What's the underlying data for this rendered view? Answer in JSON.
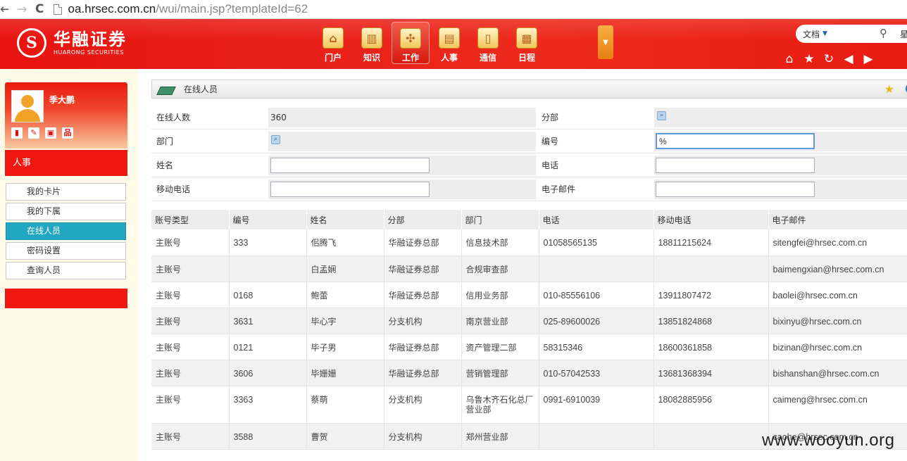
{
  "browser": {
    "url_host": "oa.hrsec.com.cn",
    "url_path": "/wui/main.jsp?templateId=62"
  },
  "header": {
    "logo_cn": "华融证券",
    "logo_en": "HUARONG SECURITIES",
    "modules": [
      {
        "label": "门户",
        "icon": "home-icon",
        "glyph": "⌂"
      },
      {
        "label": "知识",
        "icon": "book-icon",
        "glyph": "▥"
      },
      {
        "label": "工作",
        "icon": "workflow-icon",
        "glyph": "✣"
      },
      {
        "label": "人事",
        "icon": "document-icon",
        "glyph": "▤"
      },
      {
        "label": "通信",
        "icon": "phone-icon",
        "glyph": "▯"
      },
      {
        "label": "日程",
        "icon": "calendar-icon",
        "glyph": "▦"
      }
    ],
    "search_type": "文档",
    "search_extra": "星"
  },
  "sidebar": {
    "user_name": "季大鹏",
    "section_title": "人事",
    "menu": [
      {
        "label": "我的卡片",
        "active": false
      },
      {
        "label": "我的下属",
        "active": false
      },
      {
        "label": "在线人员",
        "active": true
      },
      {
        "label": "密码设置",
        "active": false
      },
      {
        "label": "查询人员",
        "active": false
      }
    ]
  },
  "panel": {
    "title": "在线人员"
  },
  "form": {
    "online_count_label": "在线人数",
    "online_count_value": "360",
    "branch_label": "分部",
    "dept_label": "部门",
    "number_label": "编号",
    "number_value": "%",
    "name_label": "姓名",
    "phone_label": "电话",
    "mobile_label": "移动电话",
    "email_label": "电子邮件"
  },
  "table": {
    "headers": [
      "账号类型",
      "编号",
      "姓名",
      "分部",
      "部门",
      "电话",
      "移动电话",
      "电子邮件"
    ],
    "rows": [
      [
        "主账号",
        "333",
        "佀腾飞",
        "华融证券总部",
        "信息技术部",
        "01058565135",
        "18811215624",
        "sitengfei@hrsec.com.cn"
      ],
      [
        "主账号",
        "",
        "白孟娴",
        "华融证券总部",
        "合规审查部",
        "",
        "",
        "baimengxian@hrsec.com.cn"
      ],
      [
        "主账号",
        "0168",
        "鲍蕾",
        "华融证券总部",
        "信用业务部",
        "010-85556106",
        "13911807472",
        "baolei@hrsec.com.cn"
      ],
      [
        "主账号",
        "3631",
        "毕心宇",
        "分支机构",
        "南京营业部",
        "025-89600026",
        "13851824868",
        "bixinyu@hrsec.com.cn"
      ],
      [
        "主账号",
        "0121",
        "毕子男",
        "华融证券总部",
        "资产管理二部",
        "58315346",
        "18600361858",
        "bizinan@hrsec.com.cn"
      ],
      [
        "主账号",
        "3606",
        "毕姗姗",
        "华融证券总部",
        "营销管理部",
        "010-57042533",
        "13681368394",
        "bishanshan@hrsec.com.cn"
      ],
      [
        "主账号",
        "3363",
        "蔡萌",
        "分支机构",
        "乌鲁木齐石化总厂营业部",
        "0991-6910039",
        "18082885956",
        "caimeng@hrsec.com.cn"
      ],
      [
        "主账号",
        "3588",
        "曹贺",
        "分支机构",
        "郑州营业部",
        "",
        "",
        "caohe@hrsec.com.cn"
      ]
    ]
  },
  "watermark": "www.wooyun.org"
}
